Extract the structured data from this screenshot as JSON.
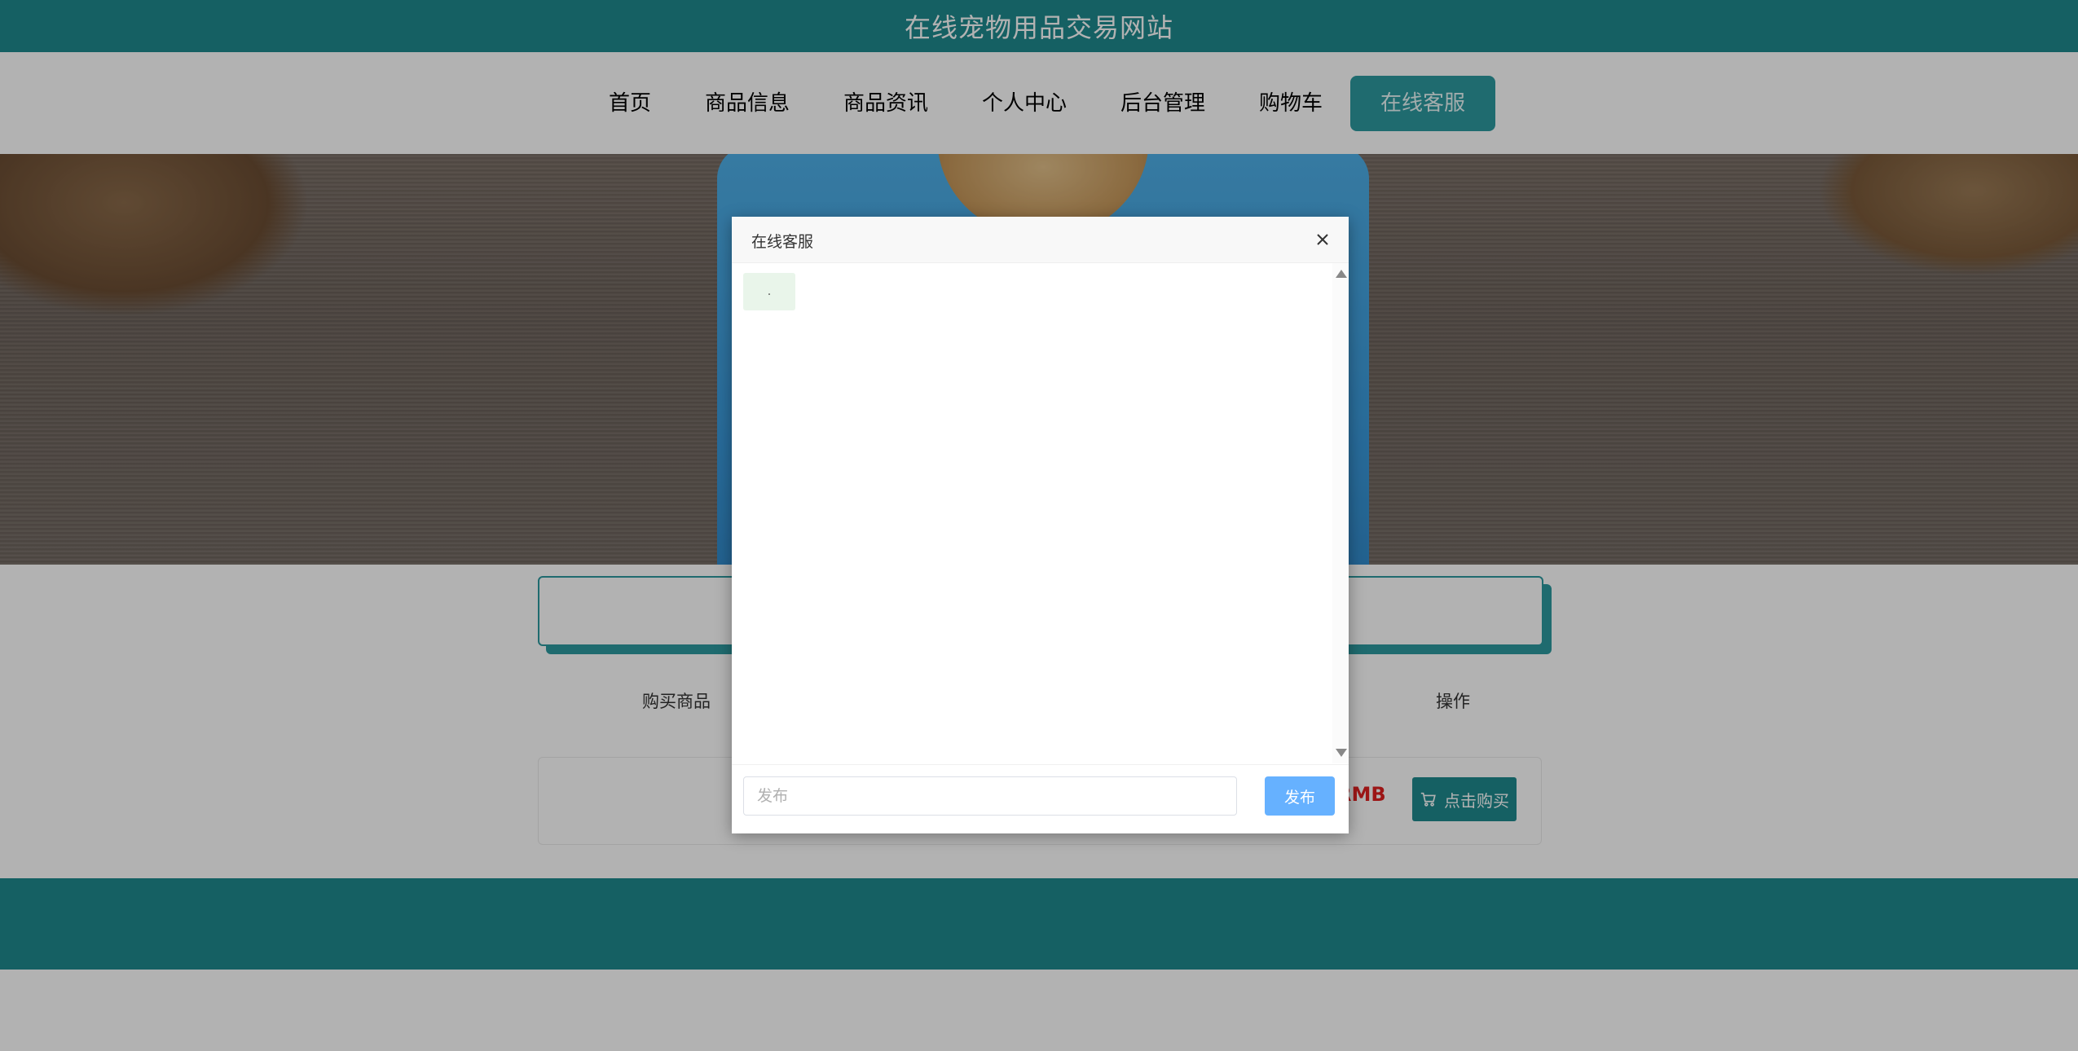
{
  "site": {
    "title": "在线宠物用品交易网站"
  },
  "nav": {
    "items": [
      {
        "label": "首页"
      },
      {
        "label": "商品信息"
      },
      {
        "label": "商品资讯"
      },
      {
        "label": "个人中心"
      },
      {
        "label": "后台管理"
      },
      {
        "label": "购物车"
      },
      {
        "label": "在线客服",
        "active": true
      }
    ]
  },
  "product_table": {
    "headers": {
      "left": "购买商品",
      "right": "操作"
    },
    "row": {
      "price_unit": "RMB",
      "buy_label": "点击购买"
    }
  },
  "chat_dialog": {
    "title": "在线客服",
    "messages": [
      {
        "text": "."
      }
    ],
    "input_placeholder": "发布",
    "send_label": "发布"
  },
  "colors": {
    "brand": "#1f8a8e",
    "active_nav": "#2d9aa0",
    "send_button": "#66b1ff",
    "price": "#e02020"
  },
  "icons": {
    "close": "close-icon",
    "cart": "cart-icon"
  }
}
